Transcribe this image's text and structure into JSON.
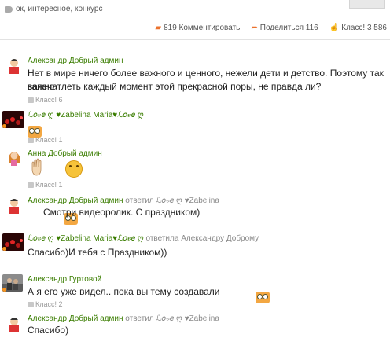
{
  "post": {
    "tags": "ок, интересное, конкурс",
    "comments": "819 Комментировать",
    "share": "Поделиться 116",
    "klass": "Класс! 3 586"
  },
  "comments": [
    {
      "author": "Александр Добрый админ",
      "text_1": "Нет в мире ничего более важного и ценного, нежели дети и детство. Поэтому так важно",
      "text_2": "запечатлеть каждый момент этой прекрасной поры, не правда ли?",
      "likes": "Класс! 6"
    },
    {
      "author": "ℒ𝑜𝓋𝑒 ღ ♥Zabelina Maria♥ℒ𝑜𝓋𝑒 ღ",
      "likes": "Класс! 1"
    },
    {
      "author": "Анна Добрый админ",
      "likes": "Класс! 1"
    },
    {
      "author": "Александр Добрый админ",
      "reply_prefix": "ответил",
      "reply_to": "ℒ𝑜𝓋𝑒 ღ ♥Zabelina",
      "text": "Смотри видеоролик. С праздником)"
    },
    {
      "author": "ℒ𝑜𝓋𝑒 ღ ♥Zabelina Maria♥ℒ𝑜𝓋𝑒 ღ",
      "reply_prefix": "ответила",
      "reply_to": "Александру Доброму",
      "text": "Спасибо)И тебя с Праздником))"
    },
    {
      "author": "Александр Гуртовой",
      "text": "А я его уже видел.. пока вы тему создавали",
      "likes": "Класс! 2"
    },
    {
      "author": "Александр Добрый админ",
      "reply_prefix": "ответил",
      "reply_to": "ℒ𝑜𝓋𝑒 ღ ♥Zabelina",
      "text": "Спасибо)"
    }
  ],
  "colors": {
    "author": "#3a7d00",
    "accent": "#eb722e",
    "meta": "#888888"
  }
}
